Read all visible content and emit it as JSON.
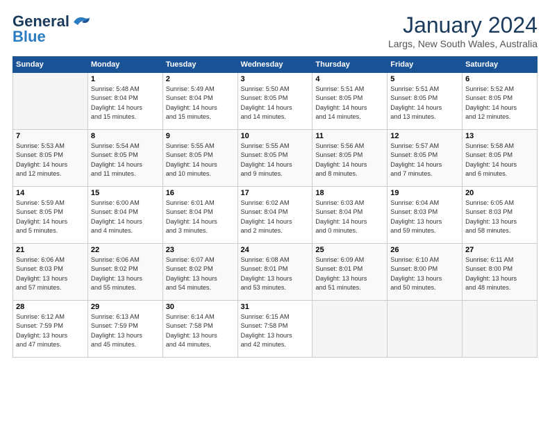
{
  "header": {
    "logo_line1": "General",
    "logo_line2": "Blue",
    "title": "January 2024",
    "location": "Largs, New South Wales, Australia"
  },
  "weekdays": [
    "Sunday",
    "Monday",
    "Tuesday",
    "Wednesday",
    "Thursday",
    "Friday",
    "Saturday"
  ],
  "weeks": [
    [
      {
        "day": "",
        "info": ""
      },
      {
        "day": "1",
        "info": "Sunrise: 5:48 AM\nSunset: 8:04 PM\nDaylight: 14 hours\nand 15 minutes."
      },
      {
        "day": "2",
        "info": "Sunrise: 5:49 AM\nSunset: 8:04 PM\nDaylight: 14 hours\nand 15 minutes."
      },
      {
        "day": "3",
        "info": "Sunrise: 5:50 AM\nSunset: 8:05 PM\nDaylight: 14 hours\nand 14 minutes."
      },
      {
        "day": "4",
        "info": "Sunrise: 5:51 AM\nSunset: 8:05 PM\nDaylight: 14 hours\nand 14 minutes."
      },
      {
        "day": "5",
        "info": "Sunrise: 5:51 AM\nSunset: 8:05 PM\nDaylight: 14 hours\nand 13 minutes."
      },
      {
        "day": "6",
        "info": "Sunrise: 5:52 AM\nSunset: 8:05 PM\nDaylight: 14 hours\nand 12 minutes."
      }
    ],
    [
      {
        "day": "7",
        "info": "Sunrise: 5:53 AM\nSunset: 8:05 PM\nDaylight: 14 hours\nand 12 minutes."
      },
      {
        "day": "8",
        "info": "Sunrise: 5:54 AM\nSunset: 8:05 PM\nDaylight: 14 hours\nand 11 minutes."
      },
      {
        "day": "9",
        "info": "Sunrise: 5:55 AM\nSunset: 8:05 PM\nDaylight: 14 hours\nand 10 minutes."
      },
      {
        "day": "10",
        "info": "Sunrise: 5:55 AM\nSunset: 8:05 PM\nDaylight: 14 hours\nand 9 minutes."
      },
      {
        "day": "11",
        "info": "Sunrise: 5:56 AM\nSunset: 8:05 PM\nDaylight: 14 hours\nand 8 minutes."
      },
      {
        "day": "12",
        "info": "Sunrise: 5:57 AM\nSunset: 8:05 PM\nDaylight: 14 hours\nand 7 minutes."
      },
      {
        "day": "13",
        "info": "Sunrise: 5:58 AM\nSunset: 8:05 PM\nDaylight: 14 hours\nand 6 minutes."
      }
    ],
    [
      {
        "day": "14",
        "info": "Sunrise: 5:59 AM\nSunset: 8:05 PM\nDaylight: 14 hours\nand 5 minutes."
      },
      {
        "day": "15",
        "info": "Sunrise: 6:00 AM\nSunset: 8:04 PM\nDaylight: 14 hours\nand 4 minutes."
      },
      {
        "day": "16",
        "info": "Sunrise: 6:01 AM\nSunset: 8:04 PM\nDaylight: 14 hours\nand 3 minutes."
      },
      {
        "day": "17",
        "info": "Sunrise: 6:02 AM\nSunset: 8:04 PM\nDaylight: 14 hours\nand 2 minutes."
      },
      {
        "day": "18",
        "info": "Sunrise: 6:03 AM\nSunset: 8:04 PM\nDaylight: 14 hours\nand 0 minutes."
      },
      {
        "day": "19",
        "info": "Sunrise: 6:04 AM\nSunset: 8:03 PM\nDaylight: 13 hours\nand 59 minutes."
      },
      {
        "day": "20",
        "info": "Sunrise: 6:05 AM\nSunset: 8:03 PM\nDaylight: 13 hours\nand 58 minutes."
      }
    ],
    [
      {
        "day": "21",
        "info": "Sunrise: 6:06 AM\nSunset: 8:03 PM\nDaylight: 13 hours\nand 57 minutes."
      },
      {
        "day": "22",
        "info": "Sunrise: 6:06 AM\nSunset: 8:02 PM\nDaylight: 13 hours\nand 55 minutes."
      },
      {
        "day": "23",
        "info": "Sunrise: 6:07 AM\nSunset: 8:02 PM\nDaylight: 13 hours\nand 54 minutes."
      },
      {
        "day": "24",
        "info": "Sunrise: 6:08 AM\nSunset: 8:01 PM\nDaylight: 13 hours\nand 53 minutes."
      },
      {
        "day": "25",
        "info": "Sunrise: 6:09 AM\nSunset: 8:01 PM\nDaylight: 13 hours\nand 51 minutes."
      },
      {
        "day": "26",
        "info": "Sunrise: 6:10 AM\nSunset: 8:00 PM\nDaylight: 13 hours\nand 50 minutes."
      },
      {
        "day": "27",
        "info": "Sunrise: 6:11 AM\nSunset: 8:00 PM\nDaylight: 13 hours\nand 48 minutes."
      }
    ],
    [
      {
        "day": "28",
        "info": "Sunrise: 6:12 AM\nSunset: 7:59 PM\nDaylight: 13 hours\nand 47 minutes."
      },
      {
        "day": "29",
        "info": "Sunrise: 6:13 AM\nSunset: 7:59 PM\nDaylight: 13 hours\nand 45 minutes."
      },
      {
        "day": "30",
        "info": "Sunrise: 6:14 AM\nSunset: 7:58 PM\nDaylight: 13 hours\nand 44 minutes."
      },
      {
        "day": "31",
        "info": "Sunrise: 6:15 AM\nSunset: 7:58 PM\nDaylight: 13 hours\nand 42 minutes."
      },
      {
        "day": "",
        "info": ""
      },
      {
        "day": "",
        "info": ""
      },
      {
        "day": "",
        "info": ""
      }
    ]
  ]
}
